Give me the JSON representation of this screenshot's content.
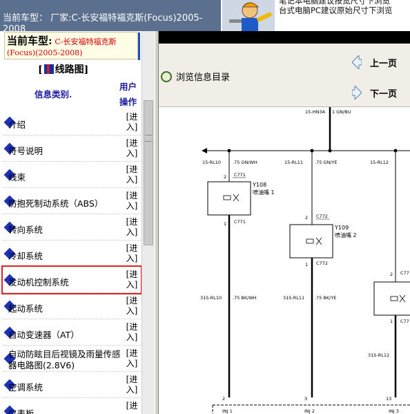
{
  "topbar": {
    "model_line": "当前车型：  厂家:C-长安福特福克斯(Focus)2005-2008",
    "note_line1": "笔记本电脑建议按宽尺寸下浏览",
    "note_line2": "台式电脑PC建议原始尺寸下浏览"
  },
  "current_model": {
    "label": "当前车型:",
    "model": "C-长安福特福克斯(Focus)(2005-2008)"
  },
  "panel": {
    "title_prefix": "[",
    "title": "线路图",
    "title_suffix": "]",
    "col_info": "信息类别.",
    "col_op_line1": "用户",
    "col_op_line2": "操作"
  },
  "menu": [
    {
      "label": "介绍",
      "enter": "[进入]"
    },
    {
      "label": "符号说明",
      "enter": "[进入]"
    },
    {
      "label": "线束",
      "enter": "[进入]"
    },
    {
      "label": "防抱死制动系统（ABS）",
      "enter": "[进入]"
    },
    {
      "label": "转向系统",
      "enter": "[进入]"
    },
    {
      "label": "冷却系统",
      "enter": "[进入]"
    },
    {
      "label": "发动机控制系统",
      "enter": "[进入]"
    },
    {
      "label": "起动系统",
      "enter": "[进入]"
    },
    {
      "label": "自动变速器（AT）",
      "enter": "[进入]"
    },
    {
      "label": "自动防眩目后视镜及雨量传感器电路图(2.8V6)",
      "enter": "[进入]"
    },
    {
      "label": "空调系统",
      "enter": "[进入]"
    },
    {
      "label": "仪表板",
      "enter": "[进"
    }
  ],
  "toolbar": {
    "browse_label": "浏览信息目录",
    "prev_label": "上一页",
    "next_label": "下一页"
  },
  "diagram": {
    "top_wire": "15-HN3A",
    "top_wire_spec": "1 GN/BU",
    "bus_labels": [
      "15-RL10",
      "15-RL11",
      "15-RL12"
    ],
    "bus_specs": [
      ".75 GN/WH",
      ".75 GN/YE"
    ],
    "connector_top": [
      "C771",
      "C772",
      "C77"
    ],
    "pin2": "2",
    "pin1": "1",
    "injectors": [
      {
        "id": "Y108",
        "name": "喷油嘴 1"
      },
      {
        "id": "Y109",
        "name": "喷油嘴 2"
      }
    ],
    "lower_labels": [
      "31S-RL10",
      "31S-RL11",
      "31S-RL12"
    ],
    "lower_specs": [
      ".75 BK/WH",
      ".75 BK/YE"
    ],
    "bottom_pins": [
      "2",
      "3",
      "13"
    ],
    "inj_labels": [
      "INJ 1",
      "INJ 2",
      "INJ 3"
    ]
  },
  "colors": {
    "accent_red": "#e02020",
    "nav_blue": "#1c33b8",
    "topbar_bg": "#5b6f8f"
  }
}
